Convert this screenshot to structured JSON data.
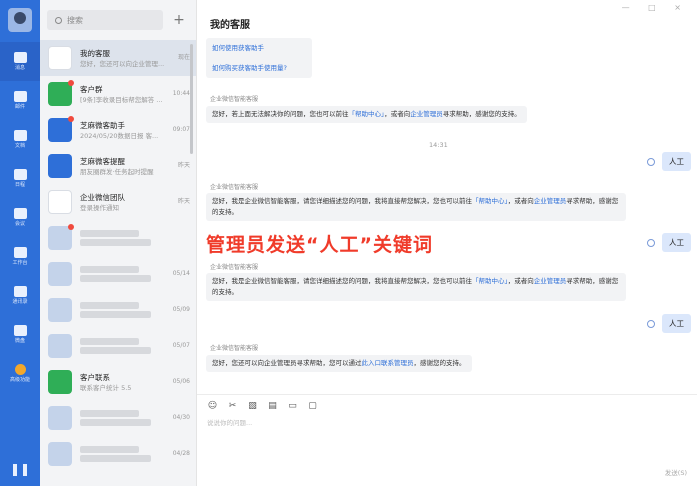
{
  "rail": {
    "items": [
      {
        "label": "消息",
        "active": true
      },
      {
        "label": "邮件"
      },
      {
        "label": "文档"
      },
      {
        "label": "日程"
      },
      {
        "label": "会议"
      },
      {
        "label": "工作台"
      },
      {
        "label": "通讯录"
      },
      {
        "label": "微盘"
      },
      {
        "label": "高级功能"
      }
    ]
  },
  "list": {
    "search_placeholder": "搜索",
    "add_label": "+",
    "conversations": [
      {
        "name": "我的客服",
        "sub": "您好，您还可以向企业管理...",
        "meta": "现在",
        "color": "#ffffff",
        "active": true
      },
      {
        "name": "客户群",
        "sub": "[9条]李收录目标帮您解答 ...",
        "meta": "10:44",
        "color": "#2fae57",
        "dot": true
      },
      {
        "name": "芝麻微客助手",
        "sub": "2024/05/20数据日报   客...",
        "meta": "09:07",
        "color": "#2e6fd8",
        "dot": true
      },
      {
        "name": "芝麻微客提醒",
        "sub": "朋友圈群发·任务起时提醒",
        "meta": "昨天",
        "color": "#2e6fd8"
      },
      {
        "name": "企业微信团队",
        "sub": "登录操作通知",
        "meta": "昨天",
        "color": "#ffffff"
      },
      {
        "name": "",
        "sub": "",
        "meta": "",
        "color": "#c4d3ea",
        "dot": true
      },
      {
        "name": "",
        "sub": "",
        "meta": "05/14",
        "color": "#c4d3ea"
      },
      {
        "name": "",
        "sub": "",
        "meta": "05/09",
        "color": "#c4d3ea"
      },
      {
        "name": "",
        "sub": "",
        "meta": "05/07",
        "color": "#c4d3ea"
      },
      {
        "name": "客户联系",
        "sub": "联系客户统计 5.5",
        "meta": "05/06",
        "color": "#2fae57"
      },
      {
        "name": "",
        "sub": "",
        "meta": "04/30",
        "color": "#c4d3ea"
      },
      {
        "name": "",
        "sub": "",
        "meta": "04/28",
        "color": "#c4d3ea"
      }
    ]
  },
  "chat": {
    "title": "我的客服",
    "window_controls": "— □ ×",
    "top_links": [
      "如何使用获客助手",
      "如何购买获客助手使用量?"
    ],
    "sender_name": "企业微信智能客服",
    "msg1_a": "您好，若上面无法解决你的问题，您也可以前往",
    "msg1_link1": "「帮助中心」",
    "msg1_b": "，或者向",
    "msg1_link2": "企业管理员",
    "msg1_c": "寻求帮助，感谢您的支持。",
    "timestamp": "14:31",
    "user_msg": "人工",
    "msg2_a": "您好，我是企业微信智能客服，请您详细描述您的问题，我将直接帮您解决，您也可以前往",
    "msg2_link1": "「帮助中心」",
    "msg2_b": "，或者向",
    "msg2_link2": "企业管理员",
    "msg2_c": "寻求帮助，感谢您的支持。",
    "msg3_a": "您好，您还可以向企业管理员寻求帮助，您可以通过",
    "msg3_link": "此入口联系管理员",
    "msg3_b": "，感谢您的支持。",
    "overlay": "管理员发送“人工”关键词",
    "composer_placeholder": "说说你的问题...",
    "send_label": "发送(S)"
  },
  "colors": {
    "accent": "#2e6fd8",
    "overlay": "#f03b2a"
  }
}
